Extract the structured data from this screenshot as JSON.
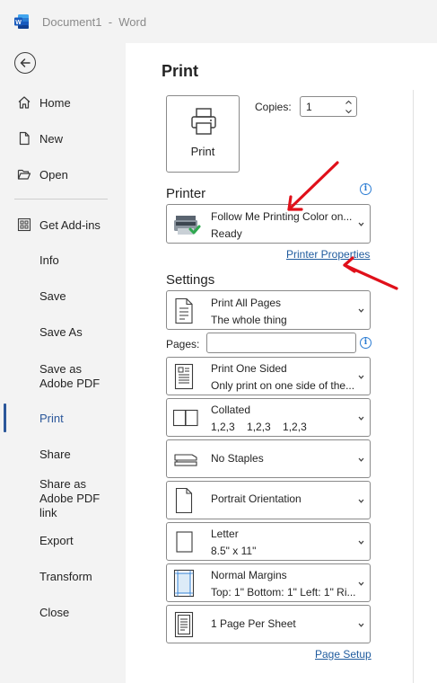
{
  "titlebar": {
    "doc_title": "Document1  -  Word",
    "app_icon": "word-app-icon"
  },
  "sidebar": {
    "back_icon": "back-arrow-icon",
    "items": [
      {
        "label": "Home",
        "icon": "home-icon"
      },
      {
        "label": "New",
        "icon": "new-document-icon"
      },
      {
        "label": "Open",
        "icon": "folder-open-icon"
      },
      {
        "label": "Get Add-ins",
        "icon": "add-ins-grid-icon"
      },
      {
        "label": "Info"
      },
      {
        "label": "Save"
      },
      {
        "label": "Save As"
      },
      {
        "label": "Save as Adobe PDF"
      },
      {
        "label": "Print",
        "selected": true
      },
      {
        "label": "Share"
      },
      {
        "label": "Share as Adobe PDF link"
      },
      {
        "label": "Export"
      },
      {
        "label": "Transform"
      },
      {
        "label": "Close"
      }
    ],
    "accent_color": "#2b579a"
  },
  "main": {
    "title": "Print",
    "print_button_label": "Print",
    "copies_label": "Copies:",
    "copies_value": "1",
    "printer_heading": "Printer",
    "printer": {
      "name": "Follow Me Printing Color on...",
      "status": "Ready"
    },
    "printer_properties_link": "Printer Properties",
    "settings_heading": "Settings",
    "settings": [
      {
        "line1": "Print All Pages",
        "line2": "The whole thing",
        "icon": "pages-icon"
      },
      {
        "line1": "Print One Sided",
        "line2": "Only print on one side of the...",
        "icon": "one-sided-icon"
      },
      {
        "line1": "Collated",
        "line2": "1,2,3    1,2,3    1,2,3",
        "icon": "collated-icon"
      },
      {
        "line1": "No Staples",
        "line2": "",
        "icon": "stapler-icon"
      },
      {
        "line1": "Portrait Orientation",
        "line2": "",
        "icon": "portrait-icon"
      },
      {
        "line1": "Letter",
        "line2": "8.5\" x 11\"",
        "icon": "letter-size-icon"
      },
      {
        "line1": "Normal Margins",
        "line2": "Top: 1\" Bottom: 1\" Left: 1\" Ri...",
        "icon": "margins-icon"
      },
      {
        "line1": "1 Page Per Sheet",
        "line2": "",
        "icon": "pages-per-sheet-icon"
      }
    ],
    "pages_label": "Pages:",
    "pages_value": "",
    "page_setup_link": "Page Setup",
    "link_color": "#1f5b9e",
    "annotation_color": "#e0101a"
  }
}
